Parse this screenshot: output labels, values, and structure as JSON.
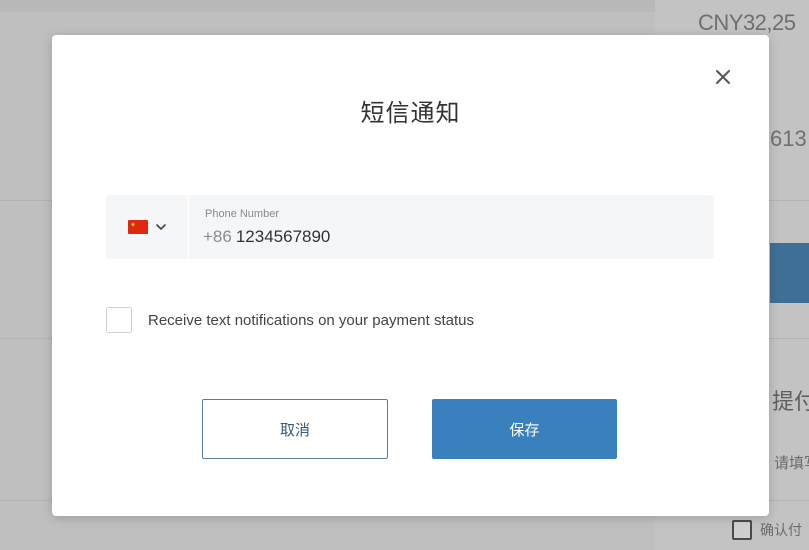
{
  "background": {
    "amount_text": "CNY32,25",
    "number_text": "613",
    "payment_heading": "提付款",
    "sub_text": "请填写",
    "confirm_label": "确认付"
  },
  "modal": {
    "title": "短信通知",
    "close_glyph": "×",
    "phone_field": {
      "country": "China",
      "flag_icon": "china-flag-icon",
      "label": "Phone Number",
      "prefix": "+86",
      "value": "1234567890"
    },
    "notify_checkbox": {
      "checked": false,
      "label": "Receive text notifications on your payment status"
    },
    "buttons": {
      "cancel": "取消",
      "save": "保存"
    }
  },
  "colors": {
    "primary": "#3a80bd",
    "overlay": "#bfbfbf",
    "field_bg": "#f5f6f8"
  }
}
